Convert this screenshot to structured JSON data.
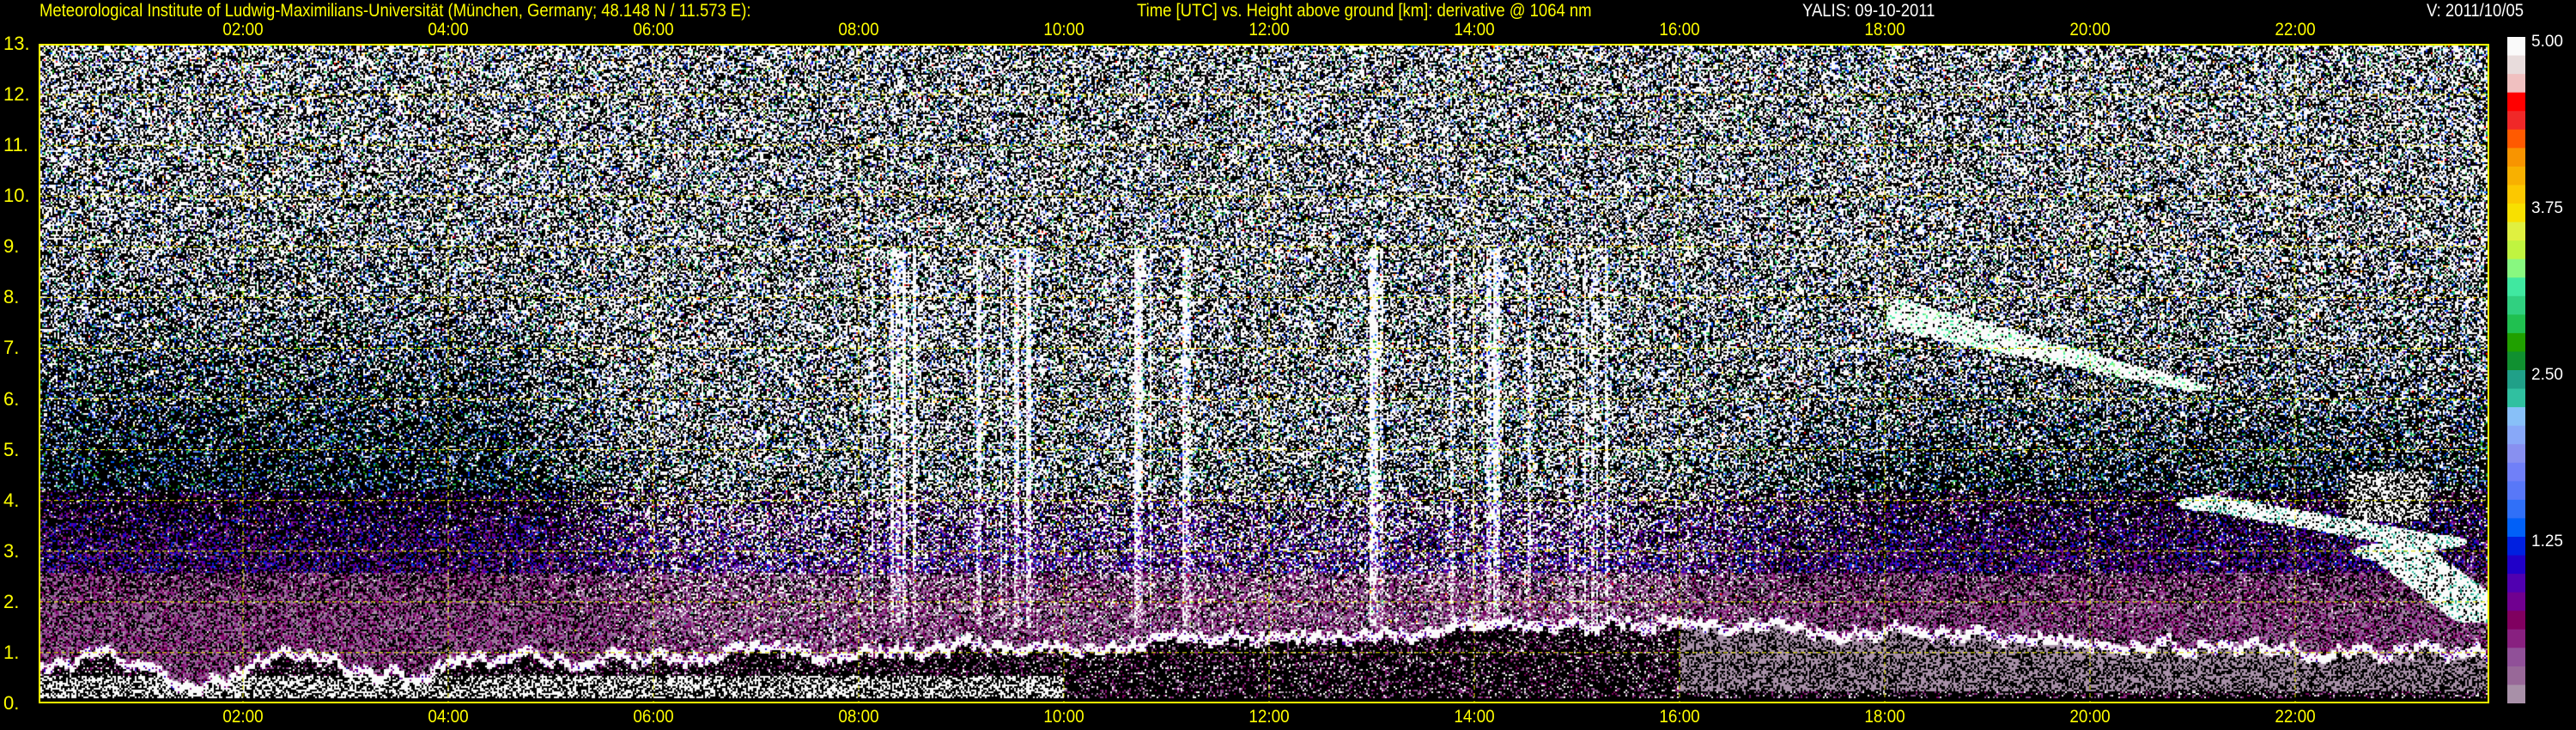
{
  "header": {
    "institute": "Meteorological Institute of Ludwig-Maximilians-Universität (München, Germany; 48.148 N / 11.573 E):",
    "axes_description": "Time [UTC] vs. Height above ground [km]: derivative @ 1064 nm",
    "instrument_date": "YALIS: 09-10-2011",
    "version": "V: 2011/10/05"
  },
  "chart_data": {
    "type": "heatmap",
    "title": "Time [UTC] vs. Height above ground [km]: derivative @ 1064 nm",
    "xlabel": "Time [UTC]",
    "ylabel": "Height above ground [km]",
    "x_range_hours": [
      0,
      23.9
    ],
    "y_range_km": [
      0,
      13
    ],
    "x_ticks": [
      "02:00",
      "04:00",
      "06:00",
      "08:00",
      "10:00",
      "12:00",
      "14:00",
      "16:00",
      "18:00",
      "20:00",
      "22:00"
    ],
    "x_tick_hours": [
      2,
      4,
      6,
      8,
      10,
      12,
      14,
      16,
      18,
      20,
      22
    ],
    "y_ticks": [
      "13.",
      "12.",
      "11.",
      "10.",
      "9.",
      "8.",
      "7.",
      "6.",
      "5.",
      "4.",
      "3.",
      "2.",
      "1.",
      "0."
    ],
    "y_tick_values": [
      13,
      12,
      11,
      10,
      9,
      8,
      7,
      6,
      5,
      4,
      3,
      2,
      1,
      0
    ],
    "grid": true,
    "colorbar": {
      "range": [
        0,
        5
      ],
      "ticks": [
        "5.00",
        "3.75",
        "2.50",
        "1.25"
      ],
      "tick_values": [
        5,
        3.75,
        2.5,
        1.25
      ],
      "colors": [
        "#fafafa",
        "#e8dcdc",
        "#f0c0c0",
        "#ff0000",
        "#f02828",
        "#ff5a00",
        "#f89400",
        "#f8b000",
        "#fcc800",
        "#f8e000",
        "#e0f040",
        "#c0f440",
        "#88f880",
        "#40e8a0",
        "#30d080",
        "#20c050",
        "#20a000",
        "#109030",
        "#20a088",
        "#30c0a0",
        "#88c0f8",
        "#88a8f8",
        "#8890f0",
        "#7080f8",
        "#5878f8",
        "#3070f8",
        "#0060f8",
        "#0020e0",
        "#2000c8",
        "#5000b0",
        "#700090",
        "#800060",
        "#882080",
        "#905098",
        "#986898",
        "#a890a8"
      ]
    },
    "features": {
      "boundary_layer_top_km": {
        "hours": [
          0,
          4,
          9,
          16,
          20,
          23.9
        ],
        "km": [
          0.6,
          0.8,
          1.1,
          1.6,
          1.2,
          1.0
        ]
      },
      "clouds": [
        {
          "start_hour": 18,
          "end_hour": 21,
          "base_km": 6.2,
          "top_km": 8.0
        },
        {
          "start_hour": 21.2,
          "end_hour": 23.9,
          "base_km": 2.2,
          "top_km": 4.5
        }
      ]
    }
  },
  "colors": {
    "axis": "#ffff00",
    "grid": "#e0e000",
    "background": "#000000"
  }
}
